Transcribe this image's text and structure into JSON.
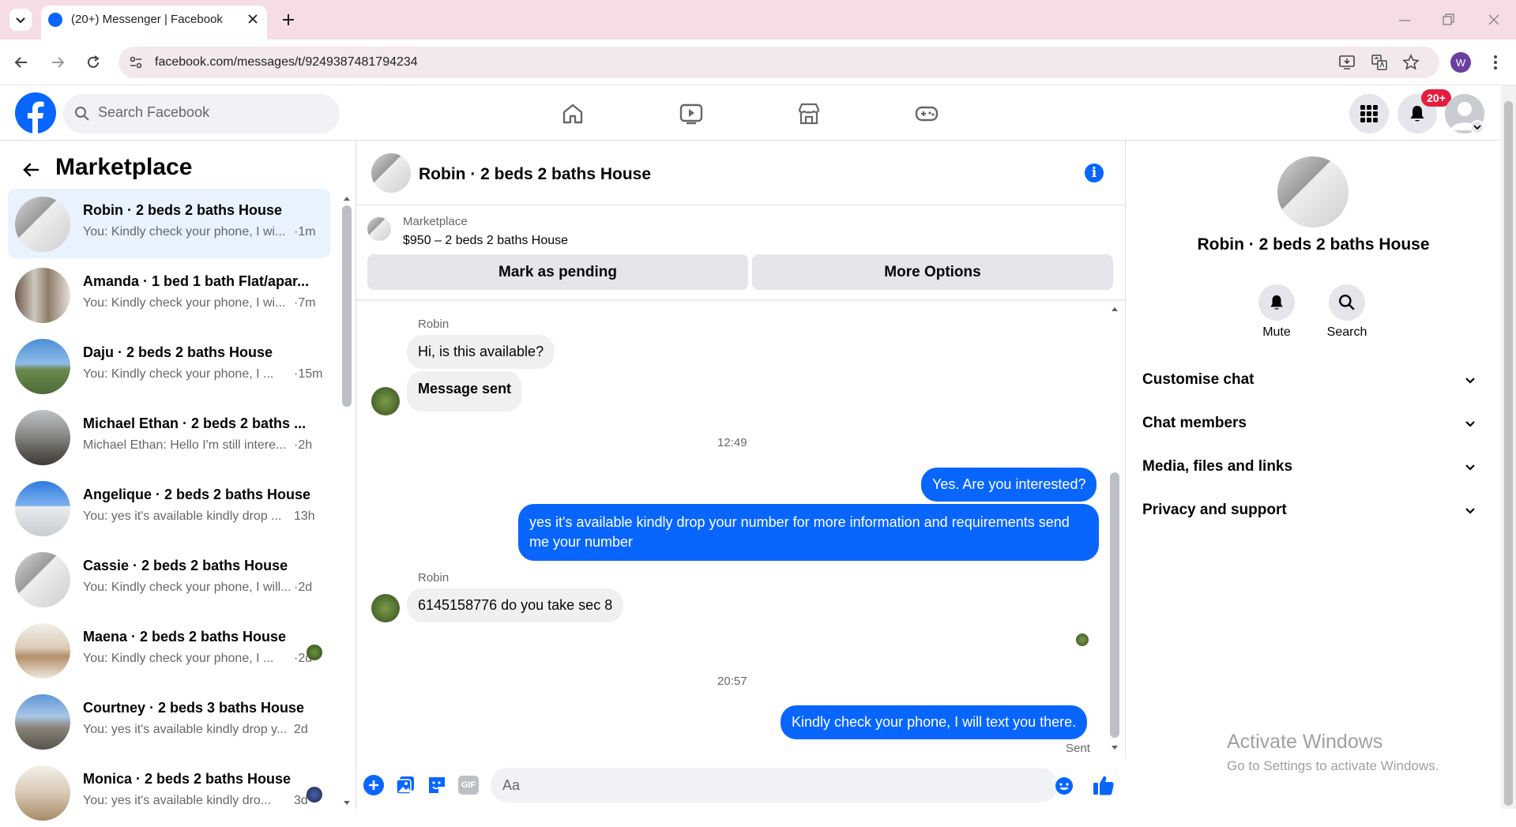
{
  "browser": {
    "tab_title": "(20+) Messenger | Facebook",
    "url": "facebook.com/messages/t/9249387481794234",
    "profile_initial": "W"
  },
  "header": {
    "search_placeholder": "Search Facebook",
    "notifications_badge": "20+",
    "brand_color": "#0866ff"
  },
  "sidebar": {
    "title": "Marketplace",
    "conversations": [
      {
        "title": "Robin · 2 beds 2 baths House",
        "snippet": "You: Kindly check your phone, I wi...",
        "time": "·1m"
      },
      {
        "title": "Amanda · 1 bed 1 bath Flat/apar...",
        "snippet": "You: Kindly check your phone, I wi...",
        "time": "·7m"
      },
      {
        "title": "Daju · 2 beds 2 baths House",
        "snippet": "You: Kindly check your phone, I ...",
        "time": "·15m"
      },
      {
        "title": "Michael Ethan · 2 beds 2 baths ...",
        "snippet": "Michael Ethan: Hello I'm still intere...",
        "time": "·2h"
      },
      {
        "title": "Angelique · 2 beds 2 baths House",
        "snippet": "You: yes it's available kindly drop ...",
        "time": "13h"
      },
      {
        "title": "Cassie · 2 beds 2 baths House",
        "snippet": "You: Kindly check your phone, I will...",
        "time": "·2d"
      },
      {
        "title": "Maena · 2 beds 2 baths House",
        "snippet": "You: Kindly check your phone, I ...",
        "time": "·2d"
      },
      {
        "title": "Courtney · 2 beds 3 baths House",
        "snippet": "You: yes it's available kindly drop y...",
        "time": "2d"
      },
      {
        "title": "Monica · 2 beds 2 baths House",
        "snippet": "You: yes it's available kindly dro...",
        "time": "3d"
      }
    ]
  },
  "chat": {
    "title": "Robin · 2 beds 2 baths House",
    "marketplace_label": "Marketplace",
    "listing": "$950 – 2 beds 2 baths House",
    "mark_pending": "Mark as pending",
    "more_options": "More Options",
    "sender1": "Robin",
    "msg1": "Hi, is this available?",
    "msg2": "Message sent",
    "time1": "12:49",
    "out1": "Yes. Are you interested?",
    "out2": "yes it's available kindly drop your number for more information and requirements send me your number",
    "sender2": "Robin",
    "msg3": "6145158776 do you take sec 8",
    "time2": "20:57",
    "out3": "Kindly check your phone, I will text you there.",
    "status": "Sent",
    "input_placeholder": "Aa"
  },
  "details": {
    "name": "Robin · 2 beds 2 baths House",
    "mute": "Mute",
    "search": "Search",
    "sections": [
      "Customise chat",
      "Chat members",
      "Media, files and links",
      "Privacy and support"
    ]
  },
  "watermark": {
    "line1": "Activate Windows",
    "line2": "Go to Settings to activate Windows."
  }
}
